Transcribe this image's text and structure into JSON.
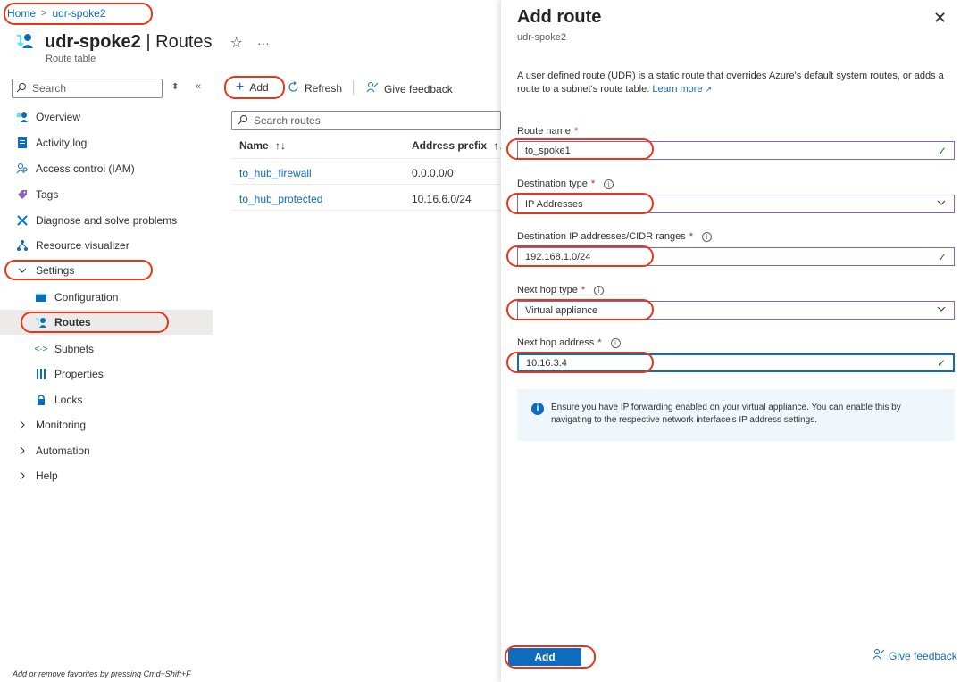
{
  "breadcrumb": {
    "home": "Home",
    "current": "udr-spoke2"
  },
  "header": {
    "title_name": "udr-spoke2",
    "title_sep": " | ",
    "title_page": "Routes",
    "subtitle": "Route table",
    "star": "☆",
    "more": "···"
  },
  "sidebar": {
    "search_placeholder": "Search",
    "items": [
      {
        "label": "Overview",
        "icon": "overview-icon"
      },
      {
        "label": "Activity log",
        "icon": "activity-log-icon"
      },
      {
        "label": "Access control (IAM)",
        "icon": "iam-icon"
      },
      {
        "label": "Tags",
        "icon": "tag-icon"
      },
      {
        "label": "Diagnose and solve problems",
        "icon": "diagnose-icon"
      },
      {
        "label": "Resource visualizer",
        "icon": "visualizer-icon"
      },
      {
        "label": "Settings",
        "icon": "chevron-down-icon"
      },
      {
        "label": "Configuration",
        "icon": "configuration-icon"
      },
      {
        "label": "Routes",
        "icon": "routes-icon"
      },
      {
        "label": "Subnets",
        "icon": "subnets-icon"
      },
      {
        "label": "Properties",
        "icon": "properties-icon"
      },
      {
        "label": "Locks",
        "icon": "lock-icon"
      },
      {
        "label": "Monitoring",
        "icon": "chevron-right-icon"
      },
      {
        "label": "Automation",
        "icon": "chevron-right-icon"
      },
      {
        "label": "Help",
        "icon": "chevron-right-icon"
      }
    ],
    "footer_tip": "Add or remove favorites by pressing Cmd+Shift+F"
  },
  "toolbar": {
    "add": "Add",
    "refresh": "Refresh",
    "feedback": "Give feedback"
  },
  "table": {
    "search_placeholder": "Search routes",
    "headers": [
      "Name",
      "Address prefix"
    ],
    "sort_glyph": "↑↓",
    "rows": [
      {
        "name": "to_hub_firewall",
        "prefix": "0.0.0.0/0"
      },
      {
        "name": "to_hub_protected",
        "prefix": "10.16.6.0/24"
      }
    ]
  },
  "panel": {
    "title": "Add route",
    "subtitle": "udr-spoke2",
    "description": "A user defined route (UDR) is a static route that overrides Azure's default system routes, or adds a route to a subnet's route table.",
    "learn_more": "Learn more",
    "fields": {
      "route_name_label": "Route name",
      "route_name_value": "to_spoke1",
      "dest_type_label": "Destination type",
      "dest_type_value": "IP Addresses",
      "dest_ip_label": "Destination IP addresses/CIDR ranges",
      "dest_ip_value": "192.168.1.0/24",
      "next_hop_type_label": "Next hop type",
      "next_hop_type_value": "Virtual appliance",
      "next_hop_addr_label": "Next hop address",
      "next_hop_addr_value": "10.16.3.4"
    },
    "required_mark": "*",
    "info_text": "Ensure you have IP forwarding enabled on your virtual appliance. You can enable this by navigating to the respective network interface's IP address settings.",
    "add_button": "Add",
    "give_feedback": "Give feedback"
  },
  "colors": {
    "accent": "#0f6cbd",
    "highlight": "#e5371a",
    "valid": "#107c10"
  }
}
